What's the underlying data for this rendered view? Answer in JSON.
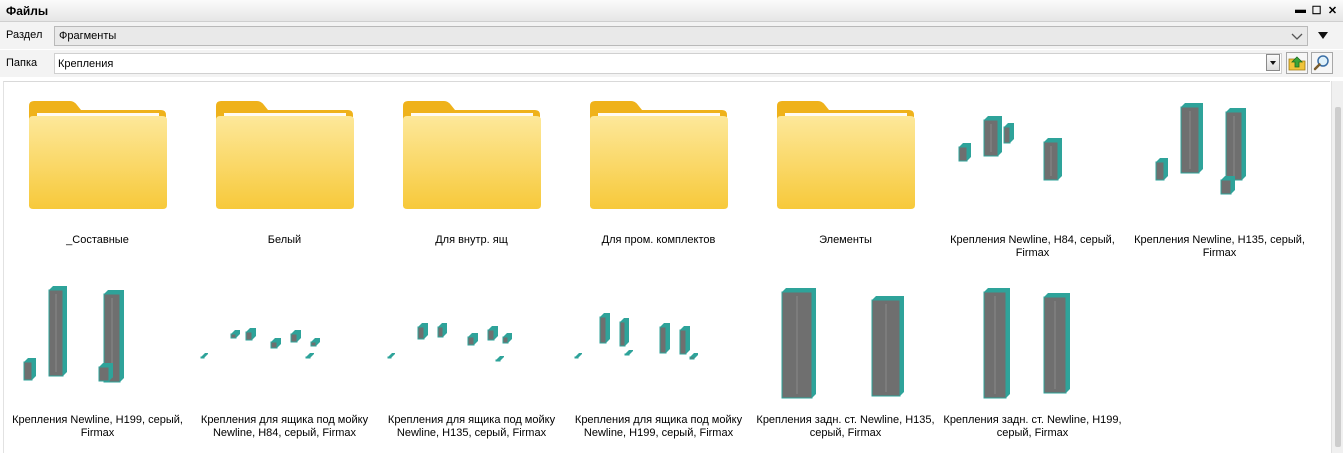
{
  "window": {
    "title": "Файлы"
  },
  "section": {
    "label": "Раздел",
    "value": "Фрагменты"
  },
  "folder": {
    "label": "Папка",
    "value": "Крепления"
  },
  "items": [
    {
      "label": "_Составные",
      "kind": "folder"
    },
    {
      "label": "Белый",
      "kind": "folder"
    },
    {
      "label": "Для внутр. ящ",
      "kind": "folder"
    },
    {
      "label": "Для пром. комплектов",
      "kind": "folder"
    },
    {
      "label": "Элементы",
      "kind": "folder"
    },
    {
      "label": "Крепления Newline, H84, серый, Firmax",
      "kind": "fragment"
    },
    {
      "label": "Крепления Newline, H135, серый, Firmax",
      "kind": "fragment"
    },
    {
      "label": "Крепления Newline, H199, серый, Firmax",
      "kind": "fragment"
    },
    {
      "label": "Крепления для ящика под мойку Newline, H84, серый, Firmax",
      "kind": "fragment"
    },
    {
      "label": "Крепления для ящика под мойку Newline, H135, серый, Firmax",
      "kind": "fragment"
    },
    {
      "label": "Крепления для ящика под мойку Newline, H199, серый, Firmax",
      "kind": "fragment"
    },
    {
      "label": "Крепления задн. ст. Newline, H135, серый, Firmax",
      "kind": "fragment"
    },
    {
      "label": "Крепления задн. ст. Newline, H199, серый, Firmax",
      "kind": "fragment"
    }
  ],
  "colors": {
    "folder_back": "#f1b61f",
    "folder_front": "#fcd660",
    "part_fill": "#6e6e6e",
    "part_edge": "#2ea39a"
  }
}
